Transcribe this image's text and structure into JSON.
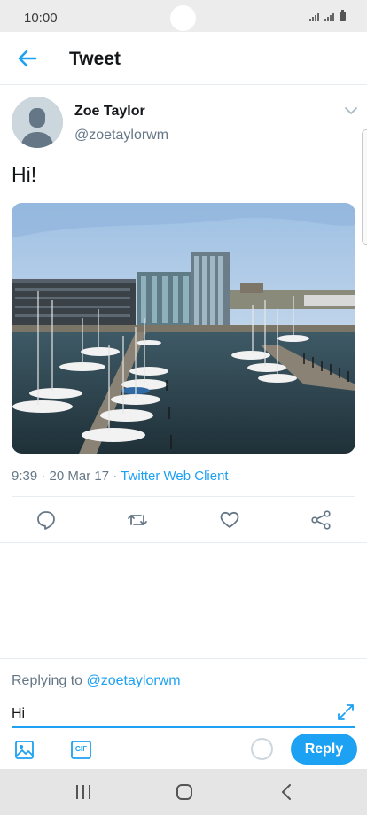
{
  "status_bar": {
    "time": "10:00"
  },
  "header": {
    "title": "Tweet"
  },
  "tweet": {
    "author_name": "Zoe Taylor",
    "author_handle": "@zoetaylorwm",
    "text": "Hi!",
    "time": "9:39",
    "date": "20 Mar 17",
    "separator": " · ",
    "source": "Twitter Web Client"
  },
  "actions": {
    "reply_icon": "speech-bubble",
    "retweet_icon": "retweet-arrows",
    "like_icon": "heart",
    "share_icon": "share-nodes"
  },
  "composer": {
    "replying_prefix": "Replying to ",
    "replying_handle": "@zoetaylorwm",
    "input_value": "Hi",
    "reply_label": "Reply",
    "gif_label": "GIF"
  },
  "colors": {
    "accent": "#1da1f2",
    "text_primary": "#14171a",
    "text_secondary": "#657786"
  }
}
